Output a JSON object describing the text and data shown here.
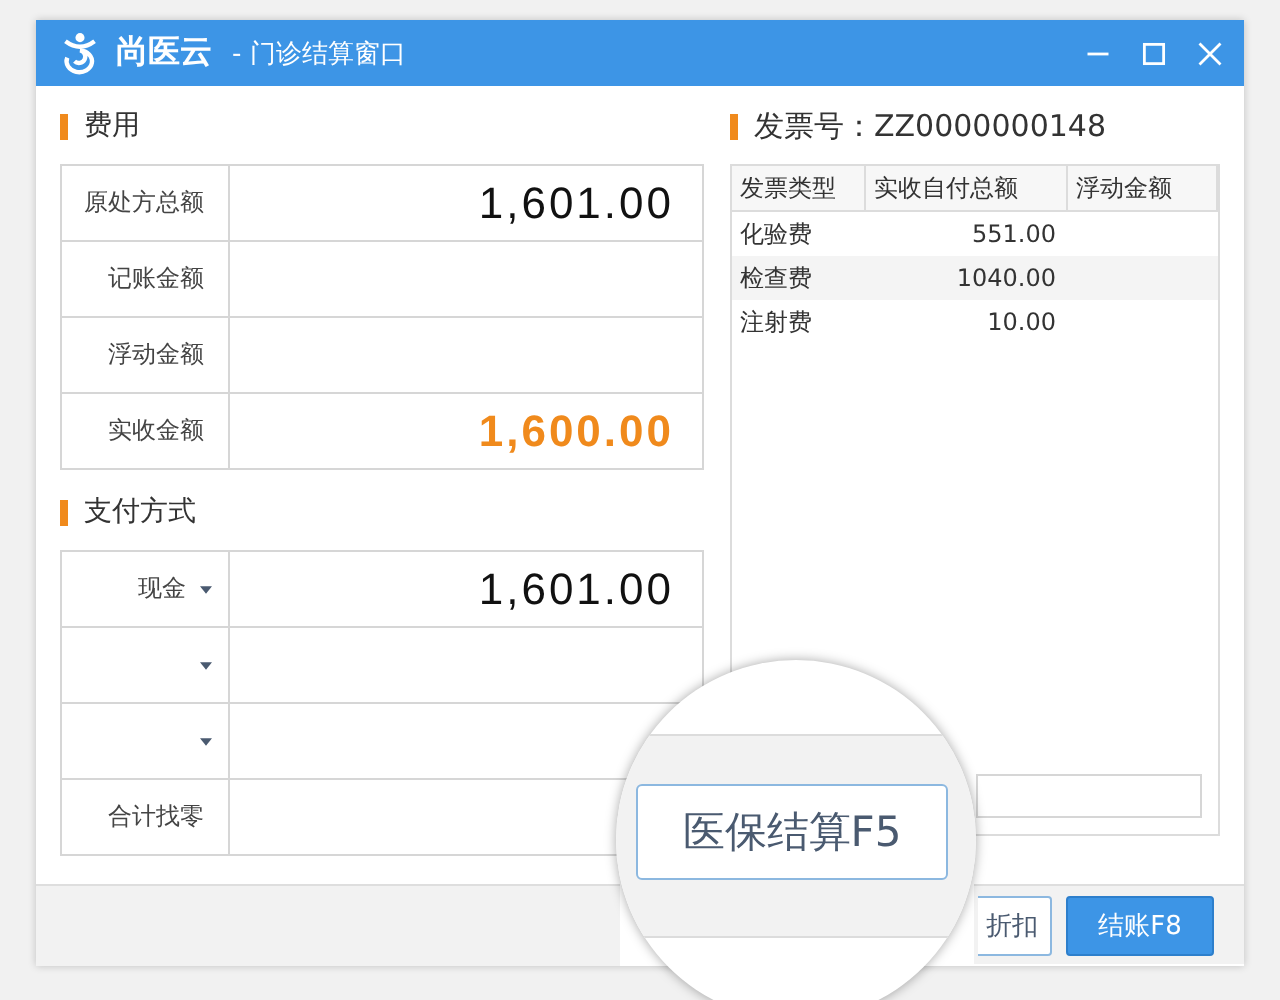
{
  "window": {
    "app_name": "尚医云",
    "title": "- 门诊结算窗口"
  },
  "fees": {
    "heading": "费用",
    "rows": [
      {
        "label": "原处方总额",
        "value": "1,601.00",
        "kind": "normal"
      },
      {
        "label": "记账金额"
      },
      {
        "label": "浮动金额"
      },
      {
        "label": "实收金额",
        "value": "1,600.00",
        "kind": "highlight"
      }
    ]
  },
  "payment": {
    "heading": "支付方式",
    "rows": [
      {
        "kind": "select",
        "label": "现金",
        "value": "1,601.00"
      },
      {
        "kind": "select"
      },
      {
        "kind": "select"
      },
      {
        "kind": "text",
        "label": "合计找零"
      }
    ]
  },
  "invoice": {
    "label": "发票号：ZZ0000000148",
    "columns": [
      "发票类型",
      "实收自付总额",
      "浮动金额"
    ],
    "rows": [
      {
        "type": "化验费",
        "amount": "551.00"
      },
      {
        "type": "检查费",
        "amount": "1040.00"
      },
      {
        "type": "注射费",
        "amount": "10.00"
      }
    ]
  },
  "buttons": [
    {
      "label": "折扣",
      "kind": "secondary"
    },
    {
      "label": "结账F8",
      "kind": "primary"
    }
  ],
  "magnifier": {
    "button": "医保结算F5"
  }
}
